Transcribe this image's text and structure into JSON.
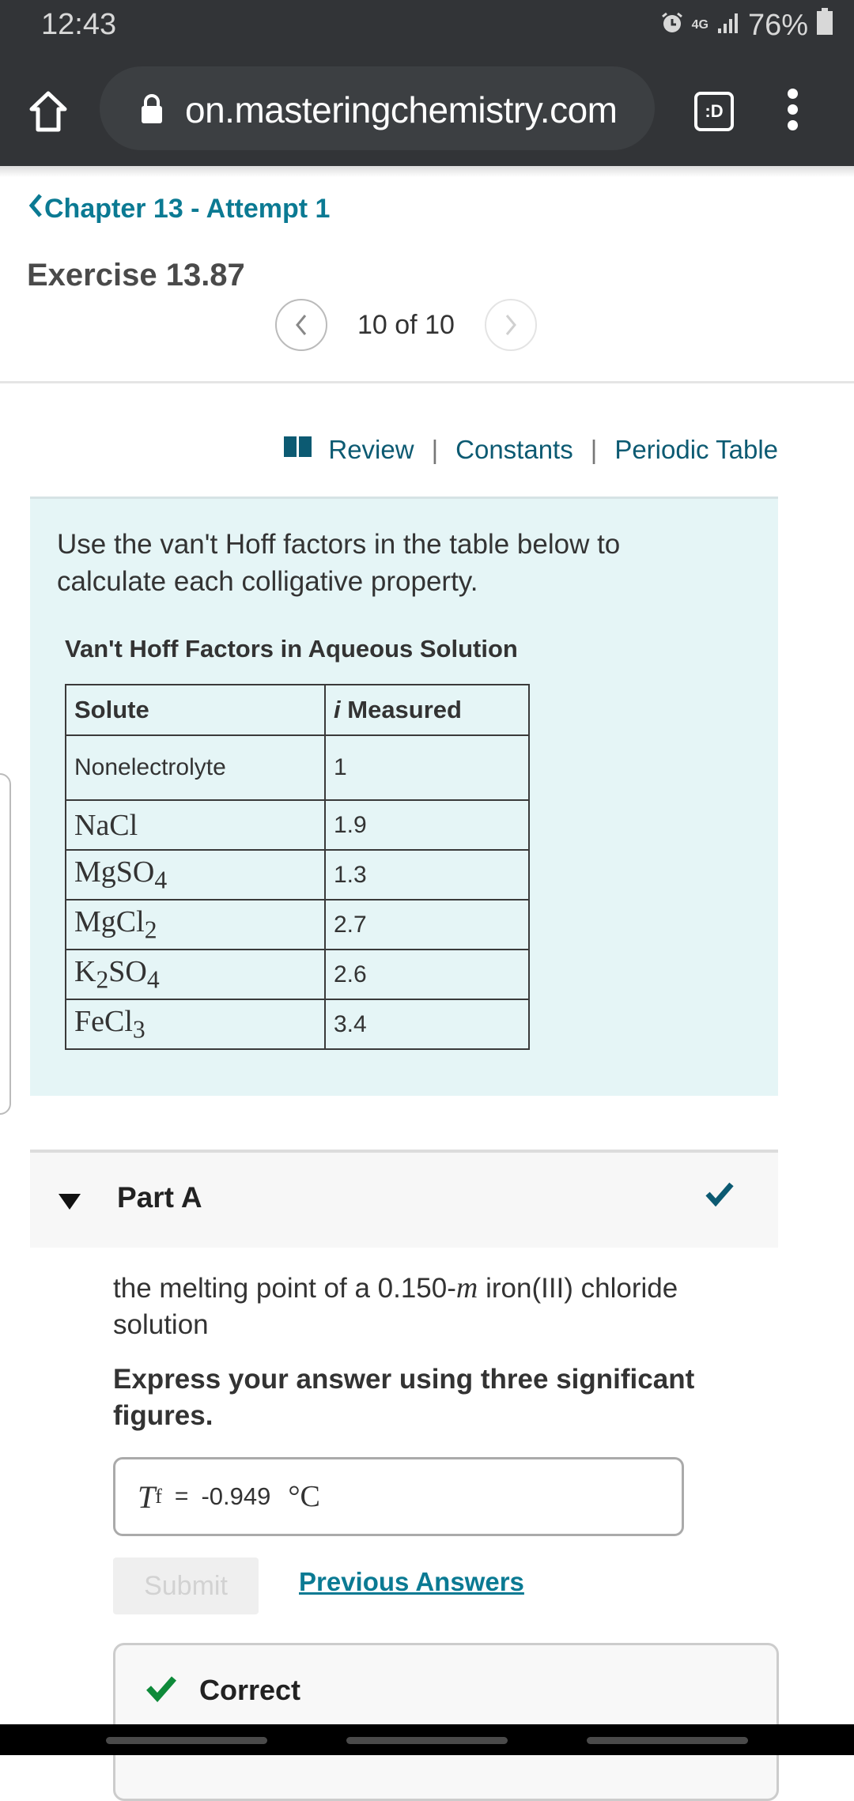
{
  "status_bar": {
    "time": "12:43",
    "network": "4G",
    "battery": "76%"
  },
  "browser": {
    "url": "on.masteringchemistry.com",
    "tabs_badge": ":D"
  },
  "header": {
    "back_link": "Chapter 13 - Attempt 1",
    "title": "Exercise 13.87",
    "pager": "10 of 10"
  },
  "resource_links": {
    "review": "Review",
    "constants": "Constants",
    "periodic_table": "Periodic Table",
    "separator": "|"
  },
  "problem": {
    "intro": "Use the van't Hoff factors in the table below to calculate each colligative property.",
    "table_caption": "Van't Hoff Factors in Aqueous Solution",
    "columns": [
      "Solute",
      "i",
      "Measured"
    ],
    "rows": [
      {
        "solute": "Nonelectrolyte",
        "i": "1"
      },
      {
        "solute": "NaCl",
        "i": "1.9"
      },
      {
        "solute": "MgSO4",
        "i": "1.3"
      },
      {
        "solute": "MgCl2",
        "i": "2.7"
      },
      {
        "solute": "K2SO4",
        "i": "2.6"
      },
      {
        "solute": "FeCl3",
        "i": "3.4"
      }
    ]
  },
  "part_a": {
    "title": "Part A",
    "question_pre": "the melting point of a 0.150-",
    "question_unit": "m",
    "question_post": " iron(III) chloride solution",
    "instruction": "Express your answer using three significant figures.",
    "answer_var": "T",
    "answer_sub": "f",
    "answer_eq": "=",
    "answer_value": "-0.949",
    "answer_unit": "°C",
    "submit_label": "Submit",
    "previous_answers": "Previous Answers",
    "feedback": "Correct"
  },
  "colors": {
    "link": "#0b7a93",
    "panel": "#e5f5f6",
    "correct": "#0e8a3a",
    "check": "#0c5a72"
  }
}
